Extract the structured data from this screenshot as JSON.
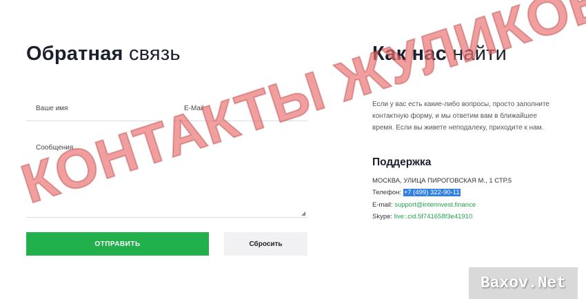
{
  "form": {
    "title_bold": "Обратная",
    "title_rest": " связь",
    "name_placeholder": "Ваше имя",
    "email_placeholder": "E-Mail",
    "message_placeholder": "Сообщения",
    "send_label": "ОТПРАВИТЬ",
    "reset_label": "Сбросить"
  },
  "find": {
    "title_bold": "Как нас",
    "title_rest": " найти",
    "description": "Если у вас есть какие-либо вопросы, просто заполните контактную форму, и мы ответим вам в ближайшее время. Если вы живете неподалеку, приходите к нам.",
    "support_title": "Поддержка",
    "address": "МОСКВА, УЛИЦА ПИРОГОВСКАЯ М., 1 СТР.5",
    "phone_label": "Телефон:",
    "phone_value": "+7 (499) 322-90-11",
    "email_label": "E-mail:",
    "email_value": "support@interinvest.finance",
    "skype_label": "Skype:",
    "skype_value": "live:.cid.5f741658f3e41910"
  },
  "overlay": {
    "stamp_text": "КОНТАКТЫ ЖУЛИКОВ",
    "site_badge": "Baxov.Net"
  },
  "colors": {
    "accent_green": "#21b04b",
    "link_green": "#21a24a",
    "highlight_blue": "#2f7fe5",
    "stamp_red": "#e44e4e"
  }
}
